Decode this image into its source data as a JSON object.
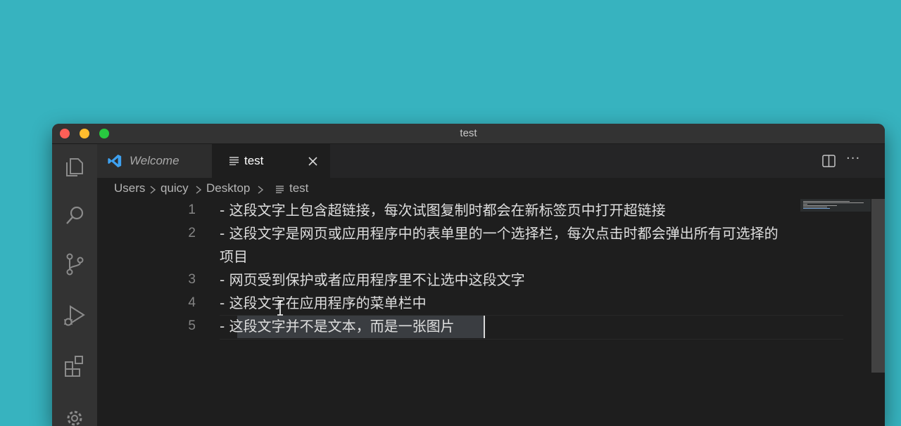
{
  "window": {
    "title": "test"
  },
  "tabs": [
    {
      "label": "Welcome",
      "icon": "vscode-logo-icon"
    },
    {
      "label": "test",
      "icon": "lines-file-icon"
    }
  ],
  "tab_actions": {
    "split": "split-editor-icon",
    "more": "···"
  },
  "breadcrumb": [
    "Users",
    "quicy",
    "Desktop",
    "test"
  ],
  "editor": {
    "lines": [
      {
        "num": "1",
        "text": "-  这段文字上包含超链接，每次试图复制时都会在新标签页中打开超链接"
      },
      {
        "num": "2",
        "text": "-  这段文字是网页或应用程序中的表单里的一个选择栏，每次点击时都会弹出所有可选择的"
      },
      {
        "num": "",
        "text": "项目"
      },
      {
        "num": "3",
        "text": "-  网页受到保护或者应用程序里不让选中这段文字"
      },
      {
        "num": "4",
        "text": "-  这段文字在应用程序的菜单栏中"
      },
      {
        "num": "5",
        "text": "-  这段文字并不是文本，而是一张图片"
      }
    ]
  },
  "colors": {
    "desktop": "#37b3bf",
    "editor_bg": "#1e1e1e",
    "selection": "#3a3d41",
    "vscode_blue": "#3ea1f0"
  }
}
